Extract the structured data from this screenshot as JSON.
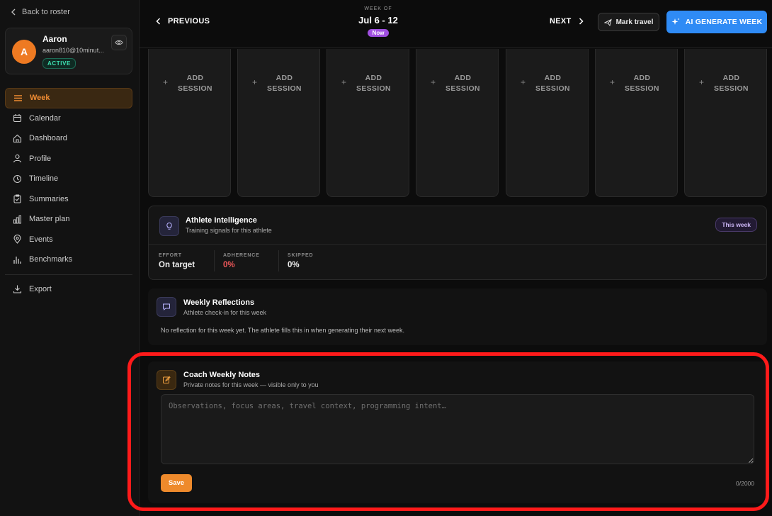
{
  "sidebar": {
    "back_label": "Back to roster",
    "user": {
      "initial": "A",
      "name": "Aaron",
      "email": "aaron810@10minut...",
      "status": "ACTIVE"
    },
    "items": [
      {
        "label": "Week",
        "icon": "list-icon",
        "active": true
      },
      {
        "label": "Calendar",
        "icon": "calendar-icon"
      },
      {
        "label": "Dashboard",
        "icon": "home-icon"
      },
      {
        "label": "Profile",
        "icon": "user-icon"
      },
      {
        "label": "Timeline",
        "icon": "clock-icon"
      },
      {
        "label": "Summaries",
        "icon": "clipboard-icon"
      },
      {
        "label": "Master plan",
        "icon": "bar-chart-icon"
      },
      {
        "label": "Events",
        "icon": "map-pin-icon"
      },
      {
        "label": "Benchmarks",
        "icon": "bars-icon"
      }
    ],
    "export_label": "Export"
  },
  "header": {
    "previous_label": "PREVIOUS",
    "week_of_label": "WEEK OF",
    "week_range": "Jul 6 - 12",
    "now_badge": "Now",
    "next_label": "NEXT",
    "mark_travel_label": "Mark travel",
    "ai_generate_label": "AI GENERATE WEEK"
  },
  "days": {
    "add_session_line1": "ADD",
    "add_session_line2": "SESSION",
    "count": 7
  },
  "intelligence": {
    "title": "Athlete Intelligence",
    "subtitle": "Training signals for this athlete",
    "badge": "This week",
    "stats": [
      {
        "label": "EFFORT",
        "value": "On target"
      },
      {
        "label": "ADHERENCE",
        "value": "0%"
      },
      {
        "label": "SKIPPED",
        "value": "0%"
      }
    ]
  },
  "reflections": {
    "title": "Weekly Reflections",
    "subtitle": "Athlete check-in for this week",
    "empty_text": "No reflection for this week yet. The athlete fills this in when generating their next week."
  },
  "notes": {
    "title": "Coach Weekly Notes",
    "subtitle": "Private notes for this week — visible only to you",
    "placeholder": "Observations, focus areas, travel context, programming intent…",
    "value": "",
    "save_label": "Save",
    "counter": "0/2000"
  },
  "colors": {
    "accent": "#ee8a2c",
    "primary": "#2f8bf5",
    "highlight_outline": "#ff1a1a"
  }
}
